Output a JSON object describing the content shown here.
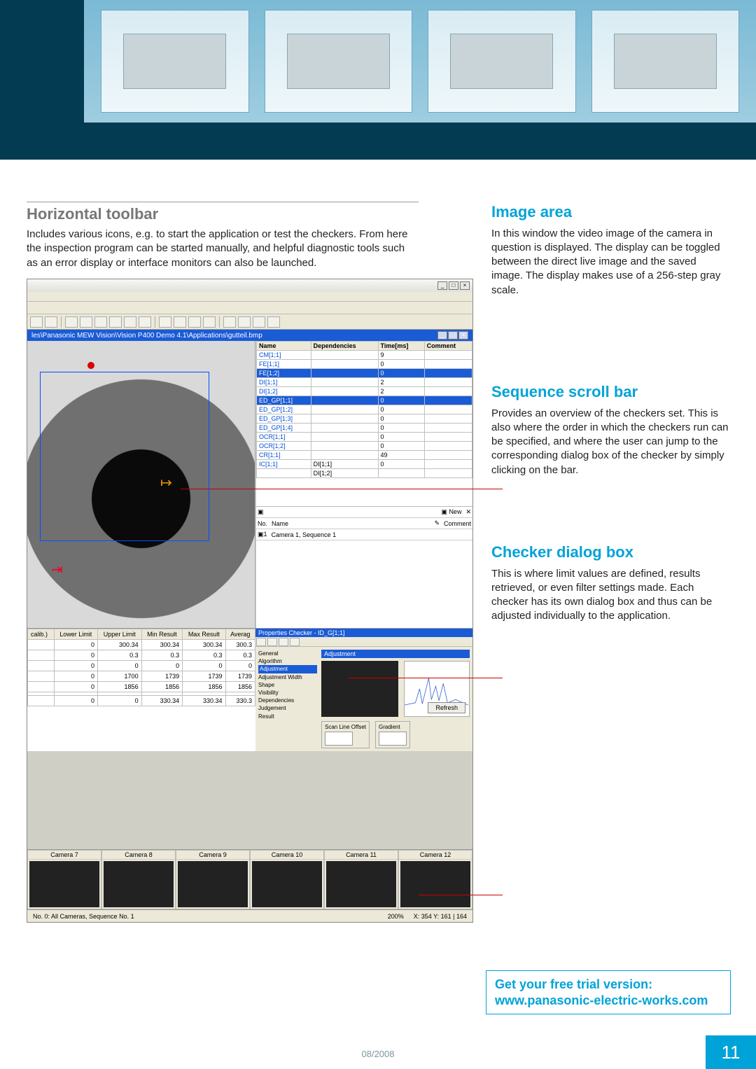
{
  "banner": {
    "caption1": "",
    "caption2": "",
    "caption3": ""
  },
  "left": {
    "heading": "Horizontal toolbar",
    "body": "Includes various icons, e.g. to start the application or test the checkers. From here the inspection program can be started manually, and helpful diagnostic tools such as an error display or interface monitors can also be launched."
  },
  "right": {
    "image_area": {
      "heading": "Image area",
      "body": "In this window the video image of the camera in question is displayed. The display can be toggled between the direct live image and the saved image. The display makes use of a 256-step gray scale."
    },
    "sequence": {
      "heading": "Sequence scroll bar",
      "body": "Provides an overview of the checkers set. This is also where the order in which the checkers run can be specified, and where the user can jump to the corresponding dialog box of the checker by simply clicking on the bar."
    },
    "checker": {
      "heading": "Checker dialog box",
      "body": "This is where limit values are defined, results retrieved, or even filter settings made. Each checker has its own dialog box and thus can be adjusted individually to the application."
    }
  },
  "app": {
    "path": "les\\Panasonic MEW Vision\\Vision P400 Demo 4.1\\Applications\\gutteil.bmp",
    "seq_header": [
      "Name",
      "Dependencies",
      "Time[ms]",
      "Comment"
    ],
    "seq_rows": [
      {
        "name": "CM[1;1]",
        "dep": "",
        "time": "9"
      },
      {
        "name": "FE[1;1]",
        "dep": "",
        "time": "0"
      },
      {
        "name": "FE[1;2]",
        "dep": "",
        "time": "0",
        "hl": true
      },
      {
        "name": "DI[1;1]",
        "dep": "",
        "time": "2"
      },
      {
        "name": "DI[1;2]",
        "dep": "",
        "time": "2"
      },
      {
        "name": "ED_GP[1;1]",
        "dep": "",
        "time": "0",
        "hl": true
      },
      {
        "name": "ED_GP[1;2]",
        "dep": "",
        "time": "0"
      },
      {
        "name": "ED_GP[1;3]",
        "dep": "",
        "time": "0"
      },
      {
        "name": "ED_GP[1;4]",
        "dep": "",
        "time": "0"
      },
      {
        "name": "OCR[1;1]",
        "dep": "",
        "time": "0"
      },
      {
        "name": "OCR[1;2]",
        "dep": "",
        "time": "0"
      },
      {
        "name": "CR[1;1]",
        "dep": "",
        "time": "49"
      },
      {
        "name": "IC[1;1]",
        "dep": "DI[1;1]",
        "time": "0"
      },
      {
        "name": "",
        "dep": "DI[1;2]",
        "time": ""
      }
    ],
    "seq2": {
      "new": "New",
      "no": "No.",
      "name": "Name",
      "comment": "Comment",
      "row": "Camera 1, Sequence 1"
    },
    "limit_header": [
      "calib.)",
      "Lower Limit",
      "Upper Limit",
      "Min Result",
      "Max Result",
      "Averag"
    ],
    "limit_rows": [
      [
        "",
        "0",
        "300.34",
        "300.34",
        "300.34",
        "300.3"
      ],
      [
        "",
        "0",
        "0.3",
        "0.3",
        "0.3",
        "0.3"
      ],
      [
        "",
        "0",
        "0",
        "0",
        "0",
        "0"
      ],
      [
        "",
        "0",
        "1700",
        "1739",
        "1739",
        "1739"
      ],
      [
        "",
        "0",
        "1856",
        "1856",
        "1856",
        "1856"
      ],
      [
        "",
        "",
        "",
        "",
        "",
        ""
      ],
      [
        "",
        "0",
        "0",
        "330.34",
        "330.34",
        "330.3"
      ]
    ],
    "checker_title": "Properties Checker - ID_G[1;1]",
    "checker_tabs": [
      "General",
      "Algorithm",
      "Adjustment",
      "Adjustment Width",
      "Shape",
      "Visibility",
      "Dependencies",
      "Judgement",
      "Result"
    ],
    "checker_tab_title": "Adjustment",
    "scanline": "Scan Line Offset",
    "gradient": "Gradient",
    "refresh": "Refresh",
    "cameras": [
      "Camera 7",
      "Camera 8",
      "Camera 9",
      "Camera 10",
      "Camera 11",
      "Camera 12"
    ],
    "status_left": "No. 0: All Cameras, Sequence No. 1",
    "status_zoom": "200%",
    "status_xy": "X: 354  Y: 161 | 164"
  },
  "promo": {
    "line1": "Get your free trial version:",
    "line2": "www.panasonic-electric-works.com"
  },
  "footer": {
    "date": "08/2008",
    "page": "11"
  }
}
